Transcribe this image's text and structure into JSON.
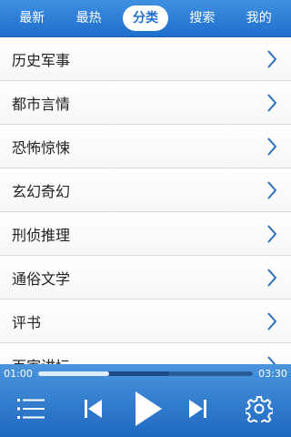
{
  "tabs": [
    {
      "label": "最新",
      "active": false
    },
    {
      "label": "最热",
      "active": false
    },
    {
      "label": "分类",
      "active": true
    },
    {
      "label": "搜索",
      "active": false
    },
    {
      "label": "我的",
      "active": false
    }
  ],
  "categories": [
    {
      "label": "历史军事"
    },
    {
      "label": "都市言情"
    },
    {
      "label": "恐怖惊悚"
    },
    {
      "label": "玄幻奇幻"
    },
    {
      "label": "刑侦推理"
    },
    {
      "label": "通俗文学"
    },
    {
      "label": "评书"
    },
    {
      "label": "百家讲坛"
    }
  ],
  "player": {
    "current_time": "01:00",
    "total_time": "03:30",
    "played_fraction": 0.33,
    "buffered_fraction": 0.61,
    "icons": {
      "playlist": "list-icon",
      "previous": "skip-previous-icon",
      "play": "play-icon",
      "next": "skip-next-icon",
      "settings": "gear-icon"
    }
  },
  "colors": {
    "accent": "#1f6fcd",
    "chevron": "#2e6fb5"
  }
}
